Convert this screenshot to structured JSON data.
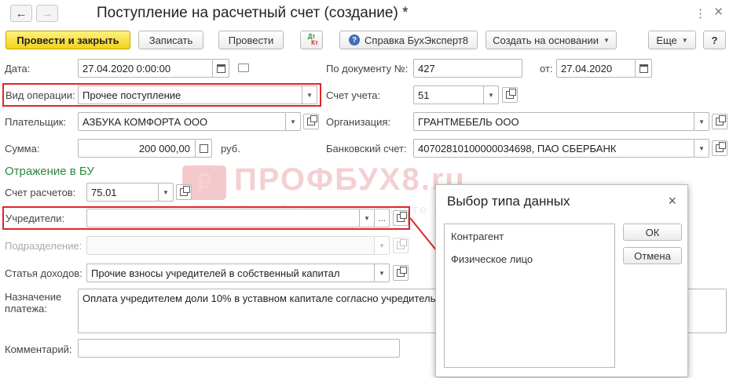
{
  "window": {
    "title": "Поступление на расчетный счет (создание) *",
    "back_icon": "←",
    "forward_icon": "→",
    "more_icon": "⋮",
    "close_icon": "×"
  },
  "toolbar": {
    "post_close": "Провести и закрыть",
    "save": "Записать",
    "post": "Провести",
    "dt_kt_top": "Дт",
    "dt_kt_bottom": "Кт",
    "help_icon": "?",
    "help": "Справка БухЭксперт8",
    "create_based": "Создать на основании",
    "more": "Еще",
    "help_q": "?",
    "caret": "▼"
  },
  "form": {
    "date_label": "Дата:",
    "date_value": "27.04.2020  0:00:00",
    "doc_no_label": "По документу №:",
    "doc_no_value": "427",
    "from_label": "от:",
    "from_value": "27.04.2020",
    "op_type_label": "Вид операции:",
    "op_type_value": "Прочее поступление",
    "account_label": "Счет учета:",
    "account_value": "51",
    "payer_label": "Плательщик:",
    "payer_value": "АЗБУКА КОМФОРТА ООО",
    "org_label": "Организация:",
    "org_value": "ГРАНТМЕБЕЛЬ ООО",
    "sum_label": "Сумма:",
    "sum_value": "200 000,00",
    "currency": "руб.",
    "bank_label": "Банковский счет:",
    "bank_value": "40702810100000034698, ПАО СБЕРБАНК",
    "section_title": "Отражение в БУ",
    "settle_label": "Счет расчетов:",
    "settle_value": "75.01",
    "founders_label": "Учредители:",
    "founders_value": "",
    "ellipsis": "...",
    "division_label": "Подразделение:",
    "division_value": "",
    "income_label": "Статья доходов:",
    "income_value": "Прочие взносы учредителей в собственный капитал",
    "purpose_label_1": "Назначение",
    "purpose_label_2": "платежа:",
    "purpose_value": "Оплата учредителем доли 10% в уставном капитале согласно учредительного договора",
    "comment_label": "Комментарий:",
    "comment_value": ""
  },
  "watermark": {
    "logo_letter": "₽",
    "brand": "ПРОФБУХ8.ru",
    "tagline": "Онлайн-курсы по работе в 1С:8"
  },
  "dialog": {
    "title": "Выбор типа данных",
    "close_icon": "×",
    "items": [
      "Контрагент",
      "Физическое лицо"
    ],
    "ok": "ОК",
    "cancel": "Отмена"
  },
  "colors": {
    "highlight": "#e0252a",
    "primary_button": "#f2d21c",
    "section_title": "#2d8a3e"
  }
}
